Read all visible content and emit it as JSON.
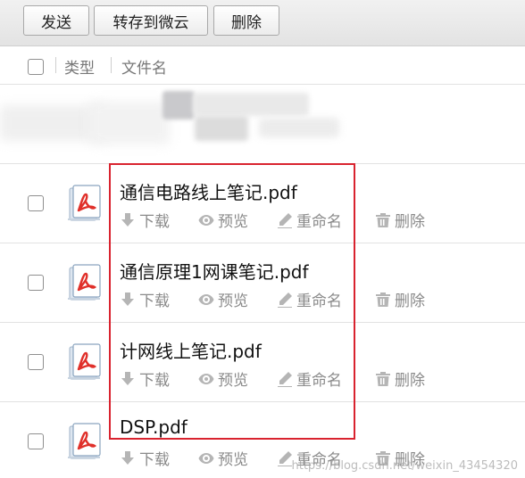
{
  "toolbar": {
    "send_label": "发送",
    "save_to_cloud_label": "转存到微云",
    "delete_label": "删除"
  },
  "table_header": {
    "type_label": "类型",
    "filename_label": "文件名"
  },
  "files": [
    {
      "name": "通信电路线上笔记.pdf"
    },
    {
      "name": "通信原理1网课笔记.pdf"
    },
    {
      "name": "计网线上笔记.pdf"
    },
    {
      "name": "DSP.pdf"
    }
  ],
  "actions": {
    "download": "下载",
    "preview": "预览",
    "rename": "重命名",
    "delete": "删除"
  },
  "icons": {
    "file_type": "pdf-file-icon",
    "download": "download-icon",
    "preview": "eye-icon",
    "rename": "pencil-icon",
    "delete": "trash-icon"
  },
  "colors": {
    "highlight_border": "#d9232f",
    "pdf_red": "#e0302a"
  },
  "watermark": "https://blog.csdn.net/weixin_43454320"
}
